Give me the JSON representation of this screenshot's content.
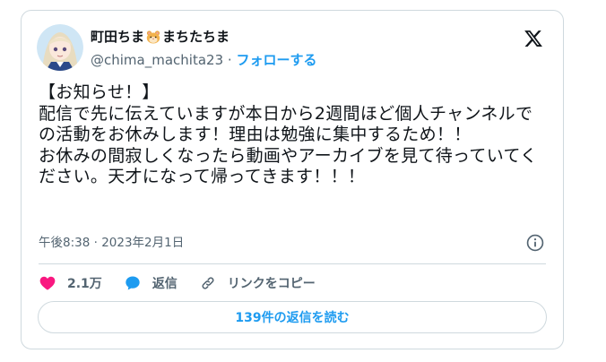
{
  "author": {
    "name_part1": "町田ちま",
    "name_part2": "まちたちま",
    "handle": "@chima_machita23",
    "separator": " · ",
    "follow_label": "フォローする"
  },
  "tweet": {
    "text": "【お知らせ！】\n配信で先に伝えていますが本日から2週間ほど個人チャンネルでの活動をお休みします！理由は勉強に集中するため！！\nお休みの間寂しくなったら動画やアーカイブを見て待っていてください。天才になって帰ってきます！！！",
    "timestamp": "午後8:38 · 2023年2月1日"
  },
  "actions": {
    "like_count": "2.1万",
    "reply_label": "返信",
    "copy_link_label": "リンクをコピー"
  },
  "read_replies_label": "139件の返信を読む",
  "icons": [
    "hamster-emoji",
    "x-logo-icon",
    "info-icon",
    "heart-icon",
    "reply-icon",
    "link-icon"
  ],
  "colors": {
    "accent": "#1d9bf0",
    "like": "#f91880",
    "secondary_text": "#536471",
    "border": "#cfd9de"
  }
}
